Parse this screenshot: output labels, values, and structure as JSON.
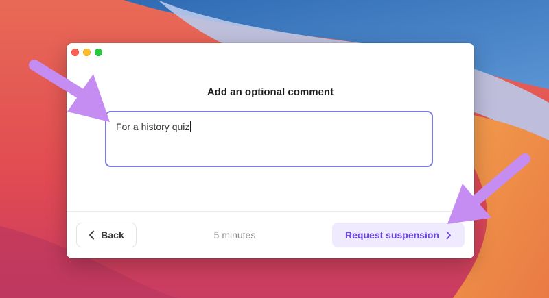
{
  "dialog": {
    "title": "Add an optional comment",
    "comment_value": "For a history quiz"
  },
  "footer": {
    "back_label": "Back",
    "duration": "5 minutes",
    "request_label": "Request suspension"
  },
  "icons": {
    "back": "chevron-left-icon",
    "request": "chevron-right-icon",
    "window_controls": [
      "close-button",
      "minimize-button",
      "zoom-button"
    ]
  },
  "colors": {
    "accent": "#6b46e3",
    "accent_bg": "#efeafd",
    "focus_border": "#7c7ce0",
    "annotation_arrow": "#c58cf2"
  }
}
